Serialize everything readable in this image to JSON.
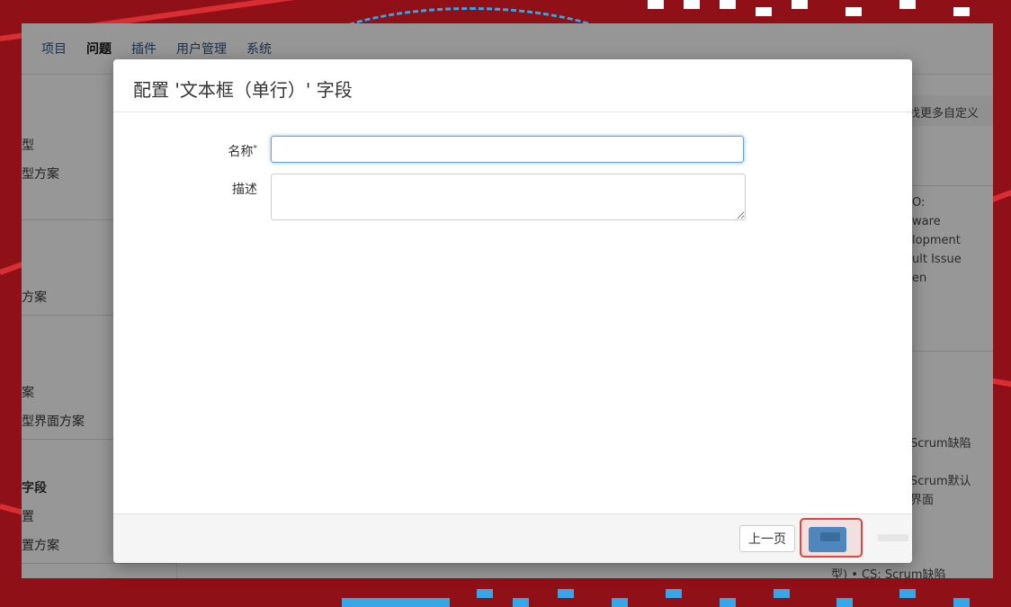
{
  "app": {
    "nav": [
      "项目",
      "问题",
      "插件",
      "用户管理",
      "系统"
    ],
    "nav_active": "问题",
    "sidebar": [
      "型",
      "型方案",
      "方案",
      "案",
      "型界面方案",
      "字段",
      "置",
      "置方案"
    ],
    "right_col": {
      "bar_text": "找更多自定义",
      "lines": [
        "O:",
        "ware",
        "lopment",
        "ult Issue",
        "en"
      ],
      "scrum1": "Scrum缺陷",
      "scrum2": "Scrum默认",
      "scrum2b": "界面",
      "bottom": "型)  •  CS: Scrum缺陷"
    }
  },
  "dialog": {
    "title": "配置 '文本框（单行）' 字段",
    "name_label": "名称",
    "required_mark": "*",
    "name_value": "",
    "desc_label": "描述",
    "desc_value": "",
    "prev_button": "上一页"
  },
  "colors": {
    "accent": "#4f86bd",
    "highlight": "#e0453f",
    "background": "#8f1017"
  }
}
